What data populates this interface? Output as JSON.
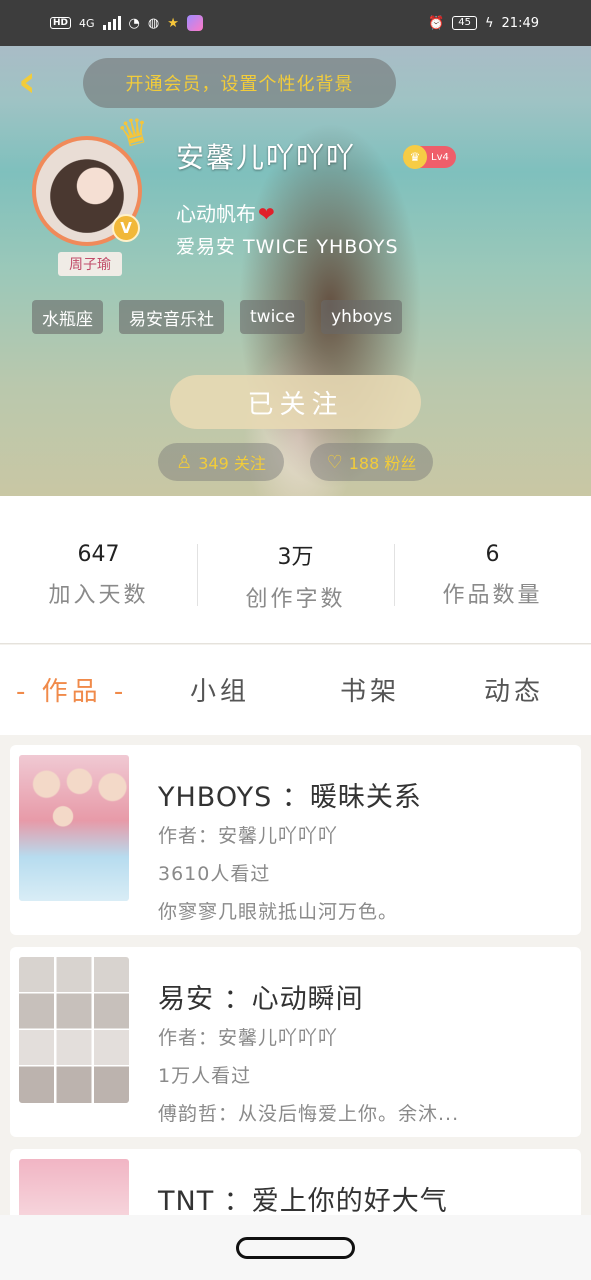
{
  "status_bar": {
    "network_hd": "HD",
    "network_4g": "4G",
    "battery": "45",
    "time": "21:49"
  },
  "header": {
    "back_icon": "chevron-left-icon",
    "vip_banner": "开通会员，设置个性化背景",
    "avatar_tag": "周子瑜",
    "verified_badge": "V",
    "username": "安馨儿吖吖吖",
    "level": "Lv4",
    "bio_line1": "心动帆布",
    "bio_heart": "❤",
    "bio_line2": "爱易安 TWICE YHBOYS",
    "tags": [
      "水瓶座",
      "易安音乐社",
      "twice",
      "yhboys"
    ],
    "follow_button": "已关注",
    "following_count": "349 关注",
    "fans_count": "188 粉丝",
    "accent_color": "#f2cc3a"
  },
  "stats": [
    {
      "value": "647",
      "label": "加入天数"
    },
    {
      "value": "3万",
      "label": "创作字数"
    },
    {
      "value": "6",
      "label": "作品数量"
    }
  ],
  "tabs": {
    "works": "- 作品 -",
    "group": "小组",
    "bookshelf": "书架",
    "moments": "动态",
    "active_color": "#f08a4a"
  },
  "works": [
    {
      "title": "YHBOYS ：暖昧关系",
      "author": "作者：安馨儿吖吖吖",
      "views": "3610人看过",
      "excerpt": "你寥寥几眼就抵山河万色。"
    },
    {
      "title": "易安 ：心动瞬间",
      "author": "作者：安馨儿吖吖吖",
      "views": "1万人看过",
      "excerpt": "傅韵哲：从没后悔爱上你。余沐..."
    },
    {
      "title": "TNT ：爱上你的好大气",
      "author": "",
      "views": "",
      "excerpt": ""
    }
  ]
}
